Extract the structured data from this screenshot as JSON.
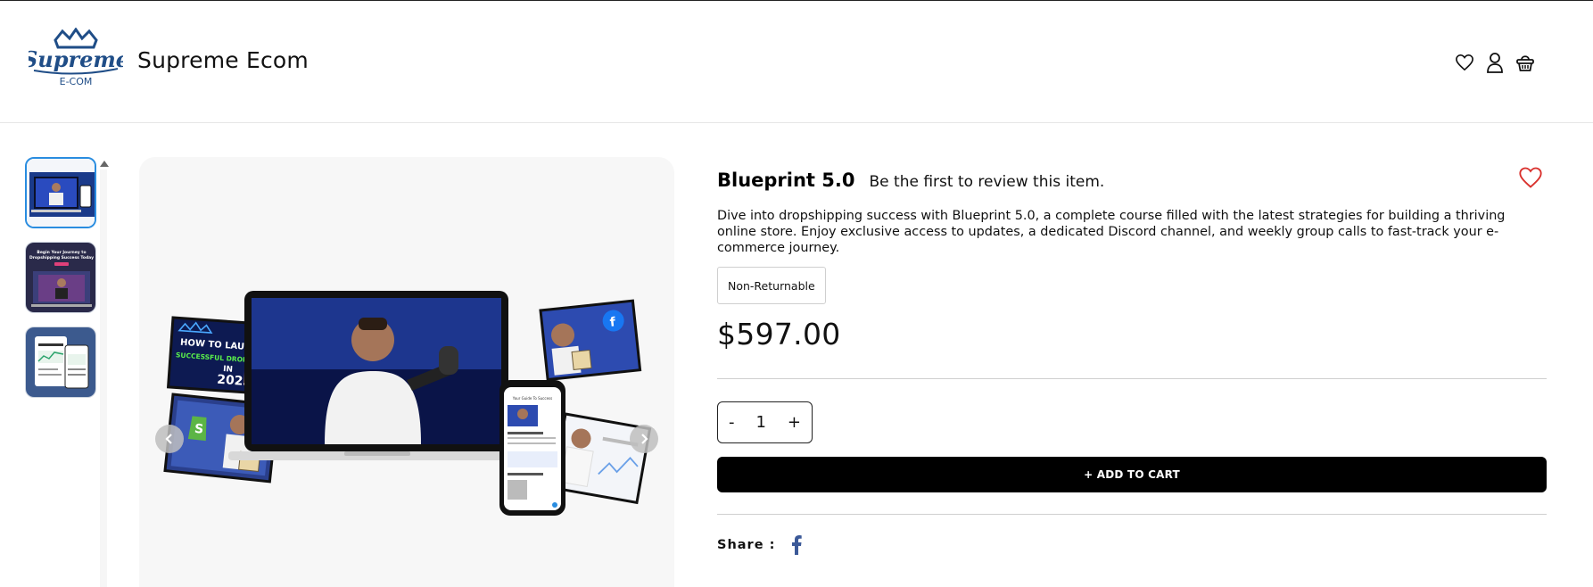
{
  "header": {
    "logo_text_top": "Supreme",
    "logo_text_bottom": "E-COM",
    "store_name": "Supreme Ecom",
    "icons": [
      "heart-icon",
      "user-icon",
      "basket-icon"
    ]
  },
  "gallery": {
    "thumbnails": [
      "thumbnail-1",
      "thumbnail-2",
      "thumbnail-3"
    ],
    "active_index": 0,
    "hero_overlay": {
      "line1": "HOW TO LAUNCH",
      "line2": "SUCCESSFUL DROPSHIPPING",
      "line3": "IN",
      "line4": "2025"
    },
    "thumb2_text": "Begin Your Journey to Dropshipping Success Today",
    "phone_text": "Your Guide To Success"
  },
  "product": {
    "title": "Blueprint 5.0",
    "review_link": "Be the first to review this item.",
    "description": "Dive into dropshipping success with Blueprint 5.0, a complete course filled with the latest strategies for building a thriving online store. Enjoy exclusive access to updates, a dedicated Discord channel, and weekly group calls to fast-track your e-commerce journey.",
    "badge": "Non-Returnable",
    "price": "$597.00",
    "quantity": {
      "minus": "-",
      "value": "1",
      "plus": "+"
    },
    "add_to_cart": "+ ADD TO CART",
    "share_label": "Share :"
  },
  "colors": {
    "accent": "#000000",
    "wishlist_heart": "#d9302c",
    "facebook": "#3b5998",
    "active_thumb_border": "#2a8de0"
  }
}
